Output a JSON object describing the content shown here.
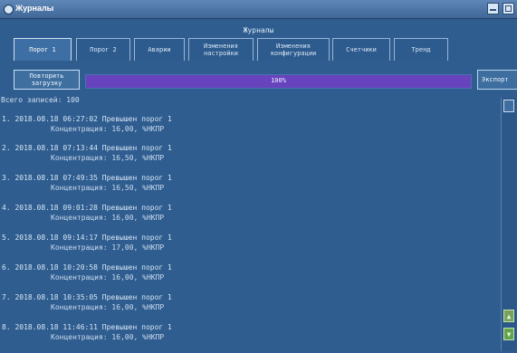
{
  "window": {
    "title": "Журналы",
    "icons": {
      "title": "app-icon",
      "minimize": "minimize-icon",
      "maximize": "maximize-icon"
    }
  },
  "section": {
    "title": "Журналы"
  },
  "tabs": [
    {
      "label": "Порог 1"
    },
    {
      "label": "Порог 2"
    },
    {
      "label": "Аварии"
    },
    {
      "label": "Изменения\nнастройки"
    },
    {
      "label": "Изменения\nконфигурации"
    },
    {
      "label": "Счетчики"
    },
    {
      "label": "Тренд"
    }
  ],
  "toolbar": {
    "reload_label": "Повторить\nзагрузку",
    "progress_text": "100%",
    "progress_percent": 100,
    "export_label": "Экспорт"
  },
  "summary": {
    "text": "Всего записей: 100"
  },
  "records": [
    {
      "line1": "1. 2018.08.18 06:27:02 Превышен порог 1",
      "line2": "Концентрация: 16,00, %НКПР"
    },
    {
      "line1": "2. 2018.08.18 07:13:44 Превышен порог 1",
      "line2": "Концентрация: 16,50, %НКПР"
    },
    {
      "line1": "3. 2018.08.18 07:49:35 Превышен порог 1",
      "line2": "Концентрация: 16,50, %НКПР"
    },
    {
      "line1": "4. 2018.08.18 09:01:28 Превышен порог 1",
      "line2": "Концентрация: 16,00, %НКПР"
    },
    {
      "line1": "5. 2018.08.18 09:14:17 Превышен порог 1",
      "line2": "Концентрация: 17,00, %НКПР"
    },
    {
      "line1": "6. 2018.08.18 10:20:58 Превышен порог 1",
      "line2": "Концентрация: 16,00, %НКПР"
    },
    {
      "line1": "7. 2018.08.18 10:35:05 Превышен порог 1",
      "line2": "Концентрация: 16,00, %НКПР"
    },
    {
      "line1": "8. 2018.08.18 11:46:11 Превышен порог 1",
      "line2": "Концентрация: 16,00, %НКПР"
    }
  ],
  "scrollbar": {
    "up_icon": "arrow-up-icon",
    "down_icon": "arrow-down-icon",
    "up_glyph": "▲",
    "down_glyph": "▼"
  }
}
